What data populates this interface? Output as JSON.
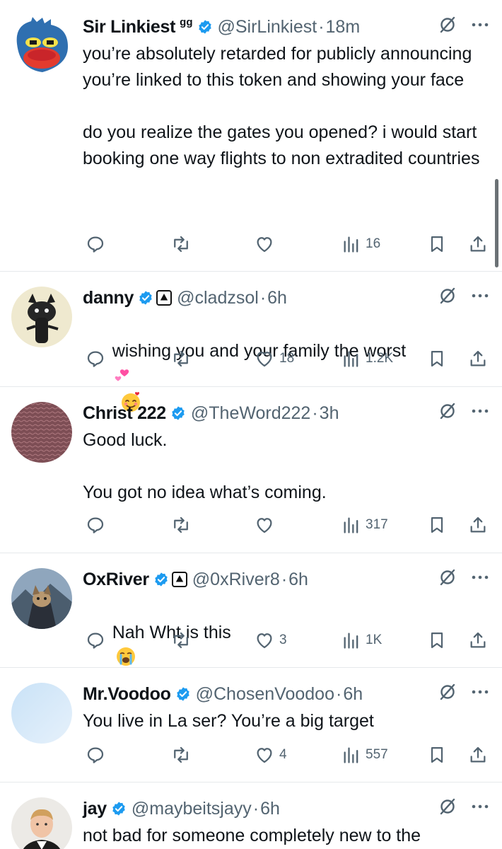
{
  "replies": [
    {
      "name": "Sir Linkiest",
      "name_suffix": "gg",
      "handle": "@SirLinkiest",
      "separator": "·",
      "time": "18m",
      "text": "you’re absolutely retarded for publicly announcing you’re linked to this token and showing your face\n\ndo you realize the gates you opened? i would start booking one way flights to non extradited countries",
      "replies_count": "",
      "reposts_count": "",
      "likes_count": "",
      "views_count": "16"
    },
    {
      "name": "danny",
      "handle": "@cladzsol",
      "separator": "·",
      "time": "6h",
      "text": "wishing you and your family the worst",
      "likes_count": "18",
      "views_count": "1.2K"
    },
    {
      "name": "Christ 222",
      "handle": "@TheWord222",
      "separator": "·",
      "time": "3h",
      "text": "Good luck.\n\nYou got no idea what’s coming.",
      "likes_count": "",
      "views_count": "317"
    },
    {
      "name": "OxRiver",
      "handle": "@0xRiver8",
      "separator": "·",
      "time": "6h",
      "text": "Nah Wht is this",
      "likes_count": "3",
      "views_count": "1K"
    },
    {
      "name": "Mr.Voodoo",
      "handle": "@ChosenVoodoo",
      "separator": "·",
      "time": "6h",
      "text": "You live in La ser? You’re a big target",
      "likes_count": "4",
      "views_count": "557"
    },
    {
      "name": "jay",
      "handle": "@maybeitsjayy",
      "separator": "·",
      "time": "6h",
      "text": "not bad for someone completely new to the"
    }
  ],
  "icons": {
    "reply": "speech-bubble-icon",
    "repost": "repost-arrows-icon",
    "like": "heart-icon",
    "views": "bar-chart-icon",
    "bookmark": "bookmark-icon",
    "share": "share-icon",
    "grok": "grok-slash-icon",
    "more": "more-dots-icon",
    "verified": "verified-badge-icon",
    "affiliate": "affiliate-triangle-icon"
  },
  "colors": {
    "verified_blue": "#1d9bf0",
    "text": "#0f1419",
    "muted": "#536471"
  }
}
